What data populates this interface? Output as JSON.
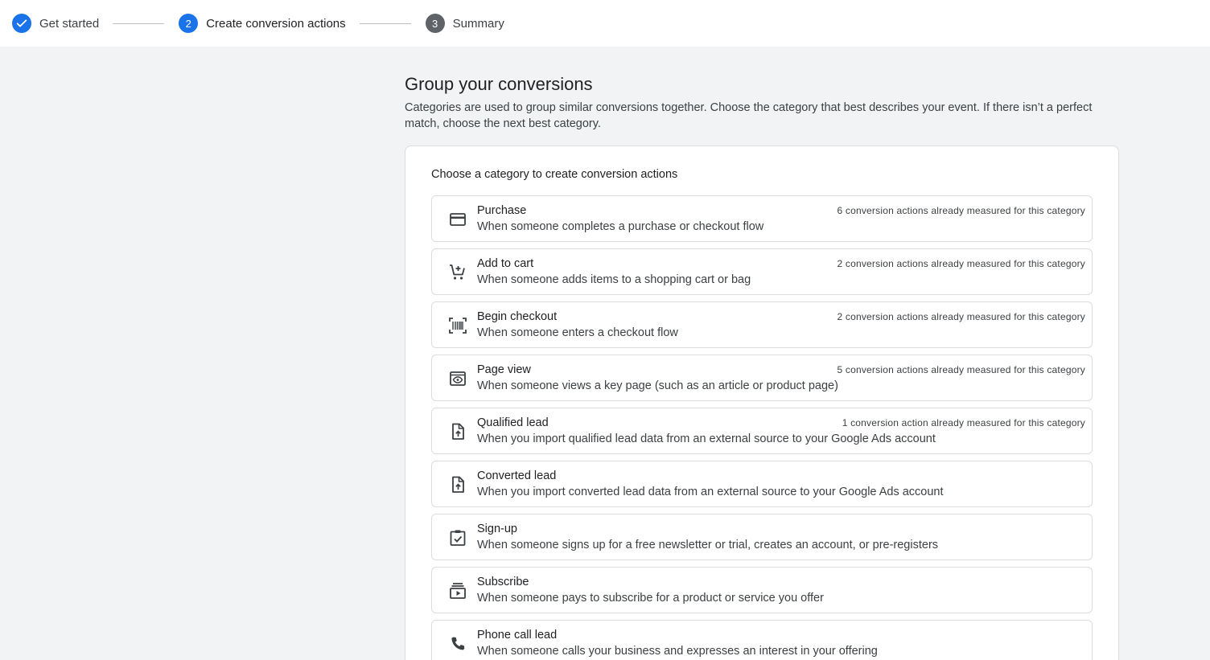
{
  "stepper": {
    "steps": [
      {
        "number": "",
        "label": "Get started",
        "state": "done"
      },
      {
        "number": "2",
        "label": "Create conversion actions",
        "state": "active"
      },
      {
        "number": "3",
        "label": "Summary",
        "state": "pending"
      }
    ]
  },
  "main": {
    "title": "Group your conversions",
    "description": "Categories are used to group similar conversions together. Choose the category that best describes your event. If there isn’t a perfect match, choose the next best category.",
    "card_title": "Choose a category to create conversion actions",
    "categories": [
      {
        "name": "Purchase",
        "description": "When someone completes a purchase or checkout flow",
        "note": "6 conversion actions already measured for this category",
        "icon": "credit-card-icon"
      },
      {
        "name": "Add to cart",
        "description": "When someone adds items to a shopping cart or bag",
        "note": "2 conversion actions already measured for this category",
        "icon": "add-shopping-cart-icon"
      },
      {
        "name": "Begin checkout",
        "description": "When someone enters a checkout flow",
        "note": "2 conversion actions already measured for this category",
        "icon": "barcode-scanner-icon"
      },
      {
        "name": "Page view",
        "description": "When someone views a key page (such as an article or product page)",
        "note": "5 conversion actions already measured for this category",
        "icon": "page-view-icon"
      },
      {
        "name": "Qualified lead",
        "description": "When you import qualified lead data from an external source to your Google Ads account",
        "note": "1 conversion action already measured for this category",
        "icon": "upload-file-icon"
      },
      {
        "name": "Converted lead",
        "description": "When you import converted lead data from an external source to your Google Ads account",
        "note": "",
        "icon": "upload-file-icon"
      },
      {
        "name": "Sign-up",
        "description": "When someone signs up for a free newsletter or trial, creates an account, or pre-registers",
        "note": "",
        "icon": "clipboard-check-icon"
      },
      {
        "name": "Subscribe",
        "description": "When someone pays to subscribe for a product or service you offer",
        "note": "",
        "icon": "subscriptions-icon"
      },
      {
        "name": "Phone call lead",
        "description": "When someone calls your business and expresses an interest in your offering",
        "note": "",
        "icon": "phone-icon"
      }
    ]
  },
  "colors": {
    "accent": "#1a73e8",
    "pending_step": "#5f6368",
    "background": "#f1f3f4",
    "border": "#dadce0"
  }
}
